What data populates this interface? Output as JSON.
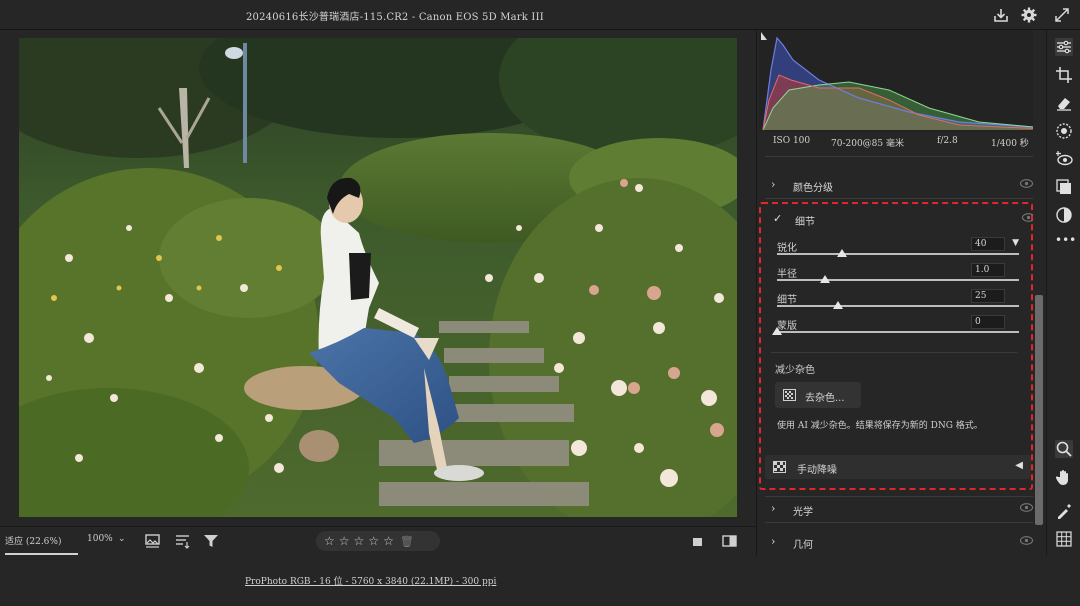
{
  "window": {
    "title": "20240616长沙普瑞酒店-115.CR2 -  Canon EOS 5D Mark III"
  },
  "top_icons": [
    "download-icon",
    "gear-icon",
    "fullscreen-icon"
  ],
  "exif": {
    "iso": "ISO 100",
    "lens": "70-200@85 毫米",
    "aperture": "f/2.8",
    "shutter": "1/400 秒"
  },
  "panel": {
    "color_grading": "颜色分级",
    "detail": "细节",
    "sliders": [
      {
        "label": "锐化",
        "value": "40",
        "fraction": 0.27
      },
      {
        "label": "半径",
        "value": "1.0",
        "fraction": 0.2
      },
      {
        "label": "细节",
        "value": "25",
        "fraction": 0.25
      },
      {
        "label": "蒙版",
        "value": "0",
        "fraction": 0.0
      }
    ],
    "noise_reduction": "减少杂色",
    "denoise_button": "去杂色...",
    "ai_note": "使用 AI 减少杂色。结果将保存为新的 DNG 格式。",
    "manual_noise": "手动降噪",
    "optics": "光学",
    "geometry": "几何"
  },
  "bottom": {
    "fit_zoom": "适应 (22.6%)",
    "zoom_100": "100%",
    "rating_stars": 5,
    "file_info": "ProPhoto RGB - 16 位 - 5760 x 3840 (22.1MP) - 300 ppi"
  },
  "colors": {
    "highlight_border": "#e3262c",
    "panel_bg": "#262626",
    "app_bg": "#1e1e1e"
  },
  "tool_icons": [
    "edit-sliders-icon",
    "crop-icon",
    "eraser-icon",
    "mask-icon",
    "redeye-icon",
    "presets-icon",
    "snapshot-icon",
    "more-icon",
    "zoom-icon",
    "hand-icon",
    "sampler-icon",
    "grid-icon"
  ]
}
